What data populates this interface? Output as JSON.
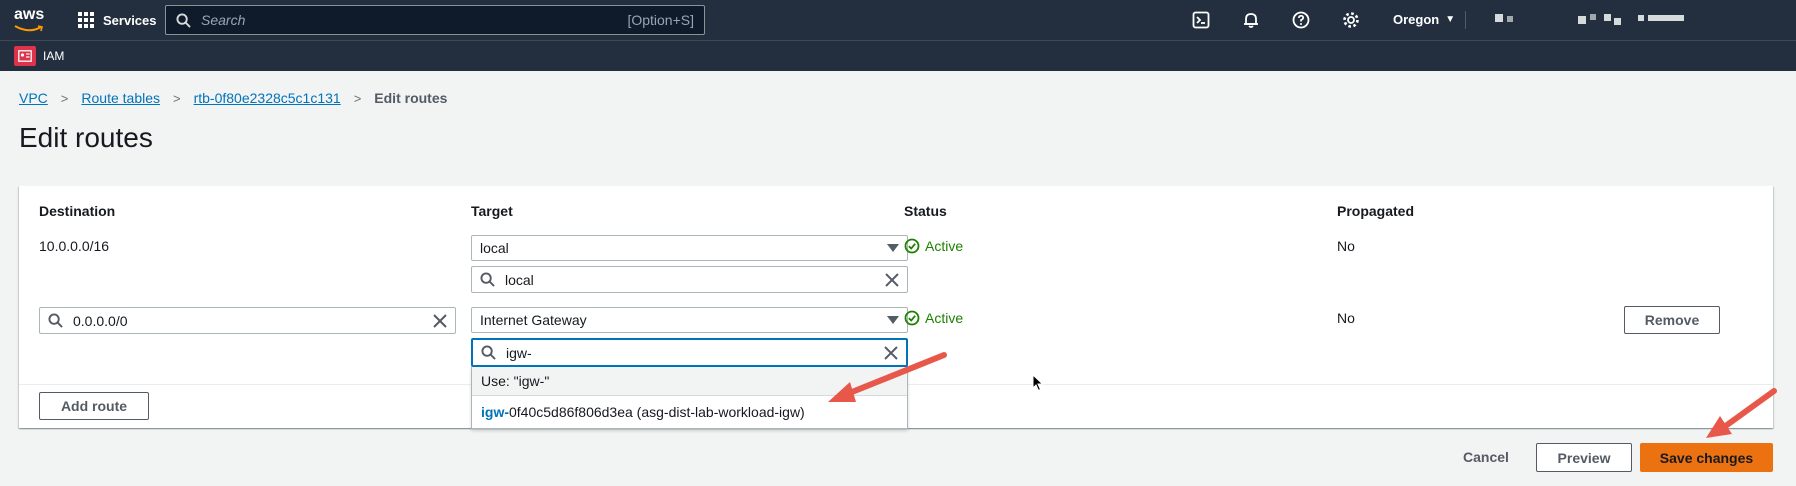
{
  "topnav": {
    "logo_text": "aws",
    "services_label": "Services",
    "search_placeholder": "Search",
    "search_shortcut": "[Option+S]",
    "region_label": "Oregon",
    "icons": [
      "cloudshell-icon",
      "notifications-icon",
      "help-icon",
      "settings-icon"
    ]
  },
  "subnav": {
    "service_label": "IAM",
    "service_icon": "iam-icon"
  },
  "breadcrumb": {
    "items": [
      "VPC",
      "Route tables",
      "rtb-0f80e2328c5c1c131"
    ],
    "current": "Edit routes"
  },
  "page": {
    "title": "Edit routes"
  },
  "table": {
    "headers": {
      "destination": "Destination",
      "target": "Target",
      "status": "Status",
      "propagated": "Propagated"
    },
    "rows": [
      {
        "destination": "10.0.0.0/16",
        "target_type": "local",
        "target_filter": "local",
        "status": "Active",
        "propagated": "No"
      },
      {
        "destination": "0.0.0.0/0",
        "target_type": "Internet Gateway",
        "target_filter": "igw-",
        "status": "Active",
        "propagated": "No",
        "remove_label": "Remove"
      }
    ],
    "dropdown": {
      "use_option": "Use: \"igw-\"",
      "match_prefix": "igw-",
      "match_rest": "0f40c5d86f806d3ea (asg-dist-lab-workload-igw)"
    },
    "add_route_label": "Add route"
  },
  "actions": {
    "cancel_label": "Cancel",
    "preview_label": "Preview",
    "save_label": "Save changes"
  },
  "colors": {
    "nav_bg": "#232f3e",
    "link": "#0073bb",
    "status_active": "#1d8102",
    "primary": "#ec7211",
    "annotation_arrow": "#e8584a"
  }
}
